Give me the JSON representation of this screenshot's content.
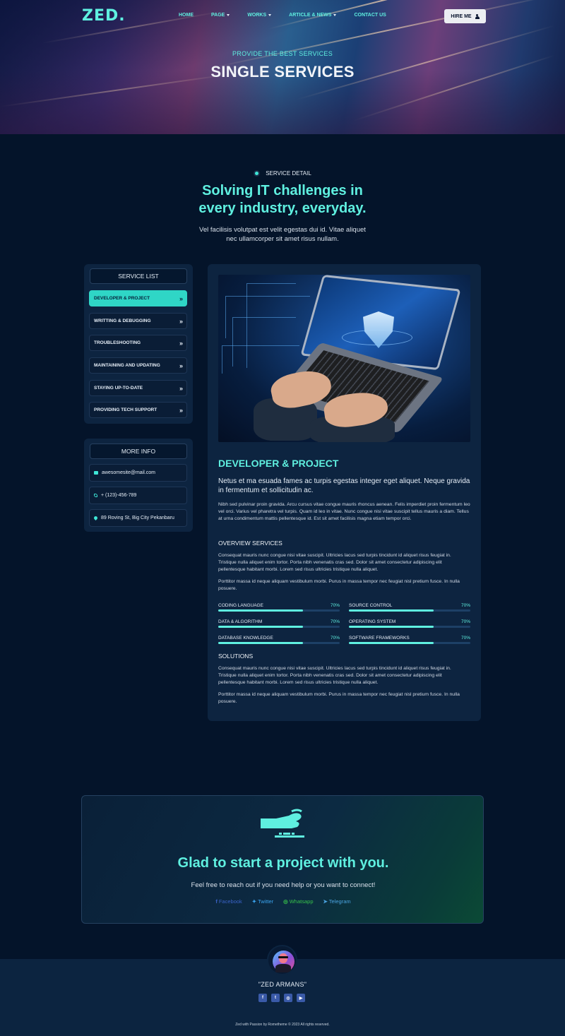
{
  "brand": {
    "logo": "ZED."
  },
  "nav": {
    "items": [
      {
        "label": "HOME",
        "dropdown": false
      },
      {
        "label": "PAGE",
        "dropdown": true
      },
      {
        "label": "WORKS",
        "dropdown": true
      },
      {
        "label": "ARTICLE & NEWS",
        "dropdown": true
      },
      {
        "label": "CONTACT US",
        "dropdown": false
      }
    ],
    "hire_label": "HIRE ME"
  },
  "hero": {
    "subtitle": "PROVIDE THE BEST SERVICES",
    "title": "SINGLE SERVICES"
  },
  "section": {
    "tag": "SERVICE DETAIL",
    "title_line1": "Solving IT challenges in",
    "title_line2": "every industry, everyday.",
    "desc": "Vel facilisis volutpat est velit egestas dui id. Vitae aliquet nec ullamcorper sit amet risus nullam."
  },
  "service_list": {
    "title": "SERVICE LIST",
    "items": [
      {
        "label": "DEVELOPER & PROJECT",
        "active": true
      },
      {
        "label": "WRITTING & DEBUGGING",
        "active": false
      },
      {
        "label": "TROUBLESHOOTING",
        "active": false
      },
      {
        "label": "MAINTAINING AND UPDATING",
        "active": false
      },
      {
        "label": "STAYING UP-TO-DATE",
        "active": false
      },
      {
        "label": "PROVIDING TECH SUPPORT",
        "active": false
      }
    ]
  },
  "more_info": {
    "title": "MORE INFO",
    "email": "awesomesite@mail.com",
    "phone": "+ (123)-456-789",
    "address": "89 Roving St, Big City Pekanbaru"
  },
  "detail": {
    "title": "DEVELOPER & PROJECT",
    "lead": "Netus et ma esuada fames ac turpis egestas integer eget aliquet. Neque gravida in fermentum et sollicitudin ac.",
    "p1": "Nibh sed pulvinar proin gravida. Arcu cursus vitae congue mauris rhoncus aenean. Felis imperdiet proin fermentum leo vel orci. Varius vel pharetra vel turpis. Quam id leo in vitae. Nunc congue nisi vitae suscipit tellus mauris a diam. Tellus at urna condimentum mattis pellentesque id. Est sit amet facilisis magna etiam tempor orci.",
    "overview_heading": "OVERVIEW SERVICES",
    "p2": "Consequat mauris nunc congue nisi vitae suscipit. Ultricies lacus sed turpis tincidunt id aliquet risus feugiat in. Tristique nulla aliquet enim tortor. Porta nibh venenatis cras sed. Dolor sit amet consectetur adipiscing elit pellentesque habitant morbi. Lorem sed risus ultricies tristique nulla aliquet.",
    "p3": "Porttitor massa id neque aliquam vestibulum morbi. Purus in massa tempor nec feugiat nisl pretium fusce. In nulla posuere.",
    "skills": [
      {
        "label": "CODING LANGUAGE",
        "pct_text": "70%",
        "value": 0.7
      },
      {
        "label": "SOURCE CONTROL",
        "pct_text": "70%",
        "value": 0.7
      },
      {
        "label": "DATA & ALGORITHM",
        "pct_text": "70%",
        "value": 0.7
      },
      {
        "label": "OPERATING SYSTEM",
        "pct_text": "70%",
        "value": 0.7
      },
      {
        "label": "DATABASE KNOWLEDGE",
        "pct_text": "70%",
        "value": 0.7
      },
      {
        "label": "SOFTWARE FRAMEWORKS",
        "pct_text": "70%",
        "value": 0.7
      }
    ],
    "solutions_heading": "SOLUTIONS",
    "p4": "Consequat mauris nunc congue nisi vitae suscipit. Ultricies lacus sed turpis tincidunt id aliquet risus feugiat in. Tristique nulla aliquet enim tortor. Porta nibh venenatis cras sed. Dolor sit amet consectetur adipiscing elit pellentesque habitant morbi. Lorem sed risus ultricies tristique nulla aliquet.",
    "p5": "Porttitor massa id neque aliquam vestibulum morbi. Purus in massa tempor nec feugiat nisl pretium fusce. In nulla posuere."
  },
  "cta": {
    "title": "Glad to start a project with you.",
    "desc": "Feel free to reach out if you need help or you want to connect!",
    "links": [
      {
        "label": "Facebook",
        "color": "#3a63c8"
      },
      {
        "label": "Twitter",
        "color": "#3aa3ee"
      },
      {
        "label": "Whatsapp",
        "color": "#37c24a"
      },
      {
        "label": "Telegram",
        "color": "#4aa3e0"
      }
    ]
  },
  "footer": {
    "name": "\"ZED ARMANS\"",
    "socials": [
      "facebook-icon",
      "twitter-icon",
      "instagram-icon",
      "youtube-icon"
    ],
    "copyright": "Zed with Passion by Rometheme © 2023 All rights reserved."
  },
  "colors": {
    "accent": "#5ff0e0",
    "background": "#04142a",
    "card": "#0d2440"
  }
}
